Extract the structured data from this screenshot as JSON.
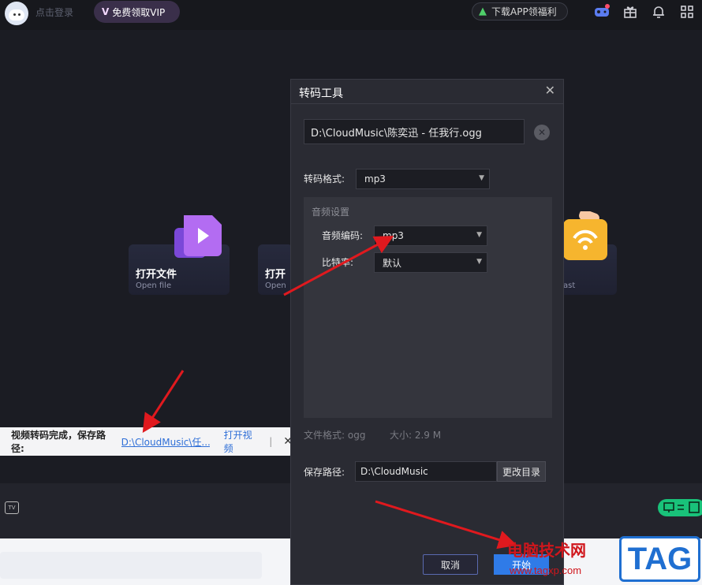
{
  "topbar": {
    "login_text": "点击登录",
    "vip_button": "免费领取VIP",
    "vip_mark": "V",
    "app_button": "下载APP领福利"
  },
  "cards": [
    {
      "title": "打开文件",
      "subtitle": "Open file"
    },
    {
      "title": "打开",
      "subtitle": "Open"
    },
    {
      "title": "",
      "subtitle": "ast"
    }
  ],
  "toast": {
    "message": "视频转码完成，保存路径:",
    "path": "D:\\CloudMusic\\任...",
    "open_video": "打开视频",
    "separator": "|",
    "close": "✕"
  },
  "dialog": {
    "title": "转码工具",
    "close": "✕",
    "file_path": "D:\\CloudMusic\\陈奕迅 - 任我行.ogg",
    "clear": "✕",
    "format_label": "转码格式:",
    "format_value": "mp3",
    "audio_settings_title": "音频设置",
    "codec_label": "音频编码:",
    "codec_value": "mp3",
    "bitrate_label": "比特率:",
    "bitrate_value": "默认",
    "file_format_label": "文件格式: ogg",
    "size_label": "大小: 2.9 M",
    "save_path_label": "保存路径:",
    "save_path_value": "D:\\CloudMusic",
    "change_dir": "更改目录",
    "cancel": "取消",
    "start": "开始"
  },
  "bottombar": {
    "tv_label": "TV"
  },
  "watermark": {
    "text": "电脑技术网",
    "url": "www.tagxp.com",
    "tag": "TAG"
  },
  "colors": {
    "accent_blue": "#2f7be8",
    "arrow_red": "#e0191e",
    "toggle_green": "#19c27a"
  }
}
